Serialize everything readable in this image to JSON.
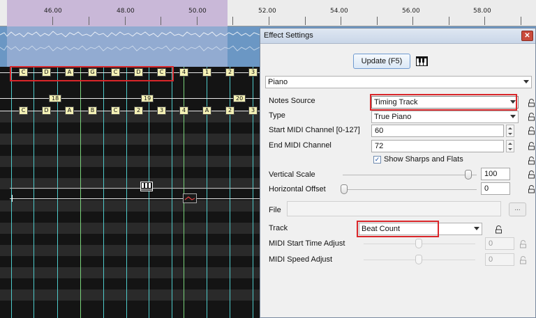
{
  "ruler": {
    "labels": [
      "46.00",
      "48.00",
      "50.00",
      "52.00",
      "54.00",
      "56.00",
      "58.00"
    ]
  },
  "timing_track": {
    "top_row_tags": [
      "C",
      "D",
      "A",
      "G",
      "C",
      "D",
      "C",
      "4",
      "1",
      "2",
      "3"
    ],
    "bar_numbers": [
      "18",
      "19",
      "20"
    ],
    "bottom_row_tags": [
      "C",
      "D",
      "A",
      "B",
      "C",
      "2",
      "3",
      "4",
      "A",
      "2",
      "3"
    ]
  },
  "dialog": {
    "title": "Effect Settings",
    "update_button": "Update (F5)",
    "effect_select": "Piano",
    "notes_source": {
      "label": "Notes Source",
      "value": "Timing Track"
    },
    "type": {
      "label": "Type",
      "value": "True Piano"
    },
    "start_midi": {
      "label": "Start MIDI Channel [0-127]",
      "value": "60"
    },
    "end_midi": {
      "label": "End MIDI Channel",
      "value": "72"
    },
    "sharps_flats": {
      "label": "Show Sharps and Flats",
      "checked": true,
      "mark": "✓"
    },
    "vertical_scale": {
      "label": "Vertical Scale",
      "value": "100"
    },
    "horizontal_offset": {
      "label": "Horizontal Offset",
      "value": "0"
    },
    "file": {
      "label": "File",
      "value": "",
      "browse": "..."
    },
    "track": {
      "label": "Track",
      "value": "Beat Count"
    },
    "midi_start": {
      "label": "MIDI Start Time Adjust",
      "value": "0"
    },
    "midi_speed": {
      "label": "MIDI Speed Adjust",
      "value": "0"
    }
  },
  "colors": {
    "highlight_red": "#d9262a",
    "tag_fill": "#f3f0b5",
    "waveform": "#6b97c4",
    "selection": "#c9b8d8"
  }
}
